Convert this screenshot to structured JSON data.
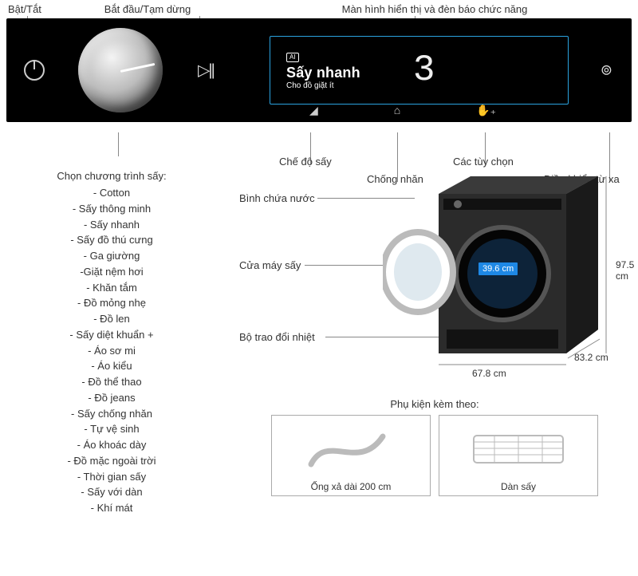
{
  "top": {
    "power": "Bật/Tắt",
    "start": "Bắt đầu/Tạm dừng",
    "display": "Màn hình hiển thị và đèn báo chức năng"
  },
  "panel": {
    "ai": "AI",
    "program": "Sấy nhanh",
    "sub": "Cho đồ giặt ít",
    "seg": "3"
  },
  "under": {
    "dial_title": "Chọn chương trình sấy:",
    "mode": "Chế độ sấy",
    "wrinkle": "Chống nhăn",
    "options": "Các tùy chọn",
    "remote": "Điều khiển từ xa"
  },
  "programs": [
    "- Cotton",
    "- Sấy thông minh",
    "- Sấy nhanh",
    "- Sấy đồ thú cưng",
    "- Ga giường",
    "-Giặt nệm hơi",
    "- Khăn tắm",
    "- Đồ mỏng nhẹ",
    "- Đồ len",
    "- Sấy diệt khuẩn +",
    "- Áo sơ mi",
    "- Áo kiểu",
    "- Đồ thể thao",
    "- Đồ jeans",
    "- Sấy chống nhăn",
    "- Tự vệ sinh",
    "- Áo khoác dày",
    "- Đồ mặc ngoài trời",
    "- Thời gian sấy",
    "- Sấy với dàn",
    "- Khí mát"
  ],
  "machine": {
    "water": "Bình chứa nước",
    "door": "Cửa máy sấy",
    "heat": "Bộ trao đổi nhiệt",
    "drum": "39.6 cm",
    "height": "97.5 cm",
    "width": "67.8 cm",
    "depth": "83.2 cm"
  },
  "accessories": {
    "title": "Phụ kiện kèm theo:",
    "hose": "Ống xả dài 200 cm",
    "rack": "Dàn sấy"
  }
}
